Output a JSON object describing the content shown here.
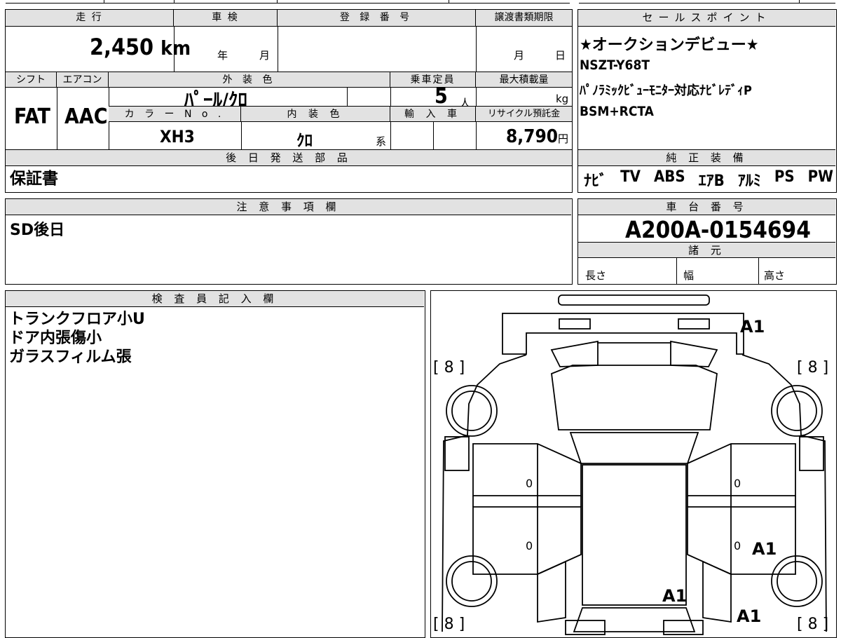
{
  "mileage": {
    "label": "走 行",
    "value": "2,450",
    "unit": "km"
  },
  "inspection": {
    "label": "車 検",
    "year_unit": "年",
    "month_unit": "月"
  },
  "registration": {
    "label": "登 録 番 号"
  },
  "transfer_deadline": {
    "label": "譲渡書類期限",
    "month_unit": "月",
    "day_unit": "日"
  },
  "shift": {
    "label": "シフト",
    "value": "FAT"
  },
  "aircon": {
    "label": "エアコン",
    "value": "AAC"
  },
  "exterior_color": {
    "label": "外 装 色",
    "value": "ﾊﾟｰﾙ/ｸﾛ"
  },
  "capacity": {
    "label": "乗車定員",
    "value": "5",
    "unit": "人"
  },
  "max_load": {
    "label": "最大積載量",
    "unit": "kg"
  },
  "color_no": {
    "label": "カ ラ ー N o .",
    "value": "XH3"
  },
  "interior_color": {
    "label": "内 装 色",
    "value": "ｸﾛ",
    "suffix": "系"
  },
  "import": {
    "label": "輸 入 車"
  },
  "recycle": {
    "label": "リサイクル預託金",
    "value": "8,790",
    "unit": "円"
  },
  "later_parts": {
    "label": "後 日 発 送 部 品",
    "value": "保証書"
  },
  "sales_point": {
    "label": "セールスポイント",
    "lines": [
      "★オークションデビュー★",
      "NSZT-Y68T",
      "ﾊﾟﾉﾗﾐｯｸﾋﾞｭｰﾓﾆﾀｰ対応ﾅﾋﾞﾚﾃﾞｨP",
      "BSM+RCTA"
    ]
  },
  "equipment": {
    "label": "純 正 装 備",
    "items": [
      "ﾅﾋﾞ",
      "TV",
      "ABS",
      "ｴｱB",
      "ｱﾙﾐ",
      "PS",
      "PW"
    ]
  },
  "notes": {
    "label": "注 意 事 項 欄",
    "value": "SD後日"
  },
  "chassis": {
    "label": "車 台 番 号",
    "value": "A200A-0154694"
  },
  "specs": {
    "label": "諸 元",
    "length": "長さ",
    "width": "幅",
    "height": "高さ"
  },
  "inspector": {
    "label": "検 査 員 記 入 欄",
    "lines": [
      "トランクフロア小U",
      "ドア内張傷小",
      "ガラスフィルム張"
    ]
  },
  "diagram": {
    "tires": [
      "[ 8 ]",
      "[ 8 ]",
      "[ 8 ]",
      "[ 8 ]"
    ],
    "marks": [
      "A1",
      "A1",
      "A1",
      "A1"
    ],
    "zeros": [
      "0",
      "0",
      "0",
      "0"
    ]
  }
}
